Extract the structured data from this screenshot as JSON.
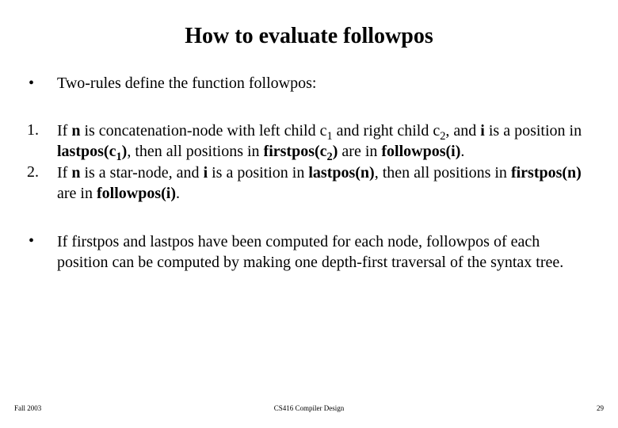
{
  "title": "How to evaluate  followpos",
  "intro": "Two-rules define the function followpos:",
  "rules": {
    "r1_pre": "If ",
    "r1_n": "n",
    "r1_mid1": " is concatenation-node with left child c",
    "r1_sub1": "1",
    "r1_mid2": " and right child c",
    "r1_sub2": "2",
    "r1_mid3": ", and ",
    "r1_i": "i",
    "r1_mid4": " is a position in ",
    "r1_lp": "lastpos(c",
    "r1_lp_sub": "1",
    "r1_lp_close": ")",
    "r1_mid5": ", then all positions in ",
    "r1_fp": "firstpos(c",
    "r1_fp_sub": "2",
    "r1_fp_close": ")",
    "r1_mid6": " are in ",
    "r1_follow": "followpos(i)",
    "r1_end": ".",
    "r2_pre": "If ",
    "r2_n": "n",
    "r2_mid1": " is a star-node, and ",
    "r2_i": "i",
    "r2_mid2": " is a position in ",
    "r2_lp": "lastpos(n)",
    "r2_mid3": ", then all positions in ",
    "r2_fp": "firstpos(n)",
    "r2_mid4": " are in ",
    "r2_follow": "followpos(i)",
    "r2_end": "."
  },
  "note": "If firstpos and lastpos have been computed for each node, followpos of each position can be computed by making one depth-first traversal of the syntax tree.",
  "footer": {
    "left": "Fall 2003",
    "center": "CS416 Compiler Design",
    "right": "29"
  },
  "markers": {
    "bullet": "•",
    "one": "1.",
    "two": "2."
  }
}
